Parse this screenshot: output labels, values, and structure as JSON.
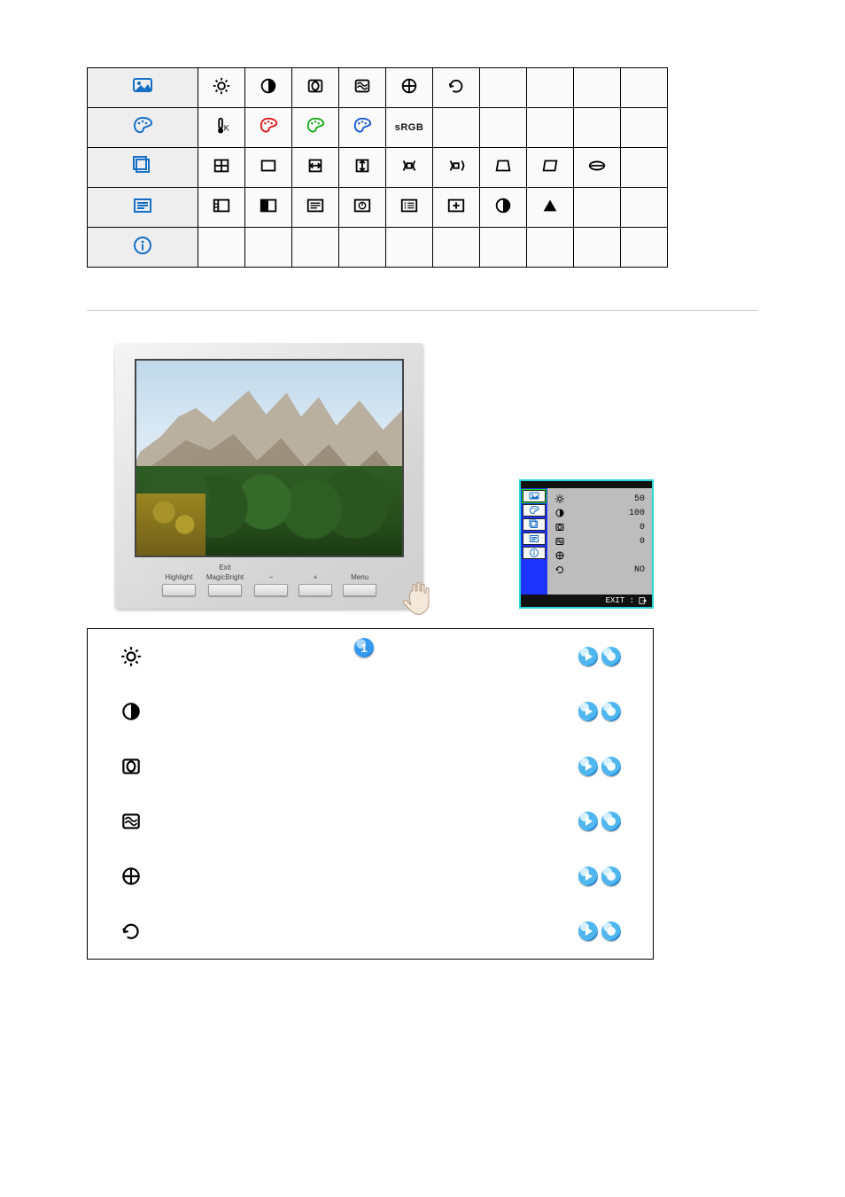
{
  "marker": "1",
  "icon_table": {
    "rows": [
      {
        "lead": "picture-main-icon",
        "cells": [
          "brightness-sun-icon",
          "contrast-halfmoon-icon",
          "degauss-icon",
          "moire-icon",
          "crosshair-icon",
          "recall-icon",
          "",
          "",
          "",
          ""
        ]
      },
      {
        "lead": "color-palette-icon",
        "cells": [
          "color-temp-icon",
          "palette-red-icon",
          "palette-green-icon",
          "palette-blue-icon",
          "srgb-label",
          "",
          "",
          "",
          "",
          ""
        ]
      },
      {
        "lead": "geometry-main-icon",
        "cells": [
          "h-position-icon",
          "h-size-icon",
          "h-center-icon",
          "v-position-icon",
          "pincushion-icon",
          "pinbalance-icon",
          "trapezoid-icon",
          "parallelogram-icon",
          "rotation-icon",
          ""
        ]
      },
      {
        "lead": "osd-main-icon",
        "cells": [
          "language-icon",
          "osd-halftone-icon",
          "osd-list-icon",
          "osd-timer-icon",
          "osd-menu-icon",
          "osd-position-icon",
          "contrast-halfmoon-icon",
          "triangle-icon",
          "",
          ""
        ]
      },
      {
        "lead": "info-icon",
        "cells": [
          "",
          "",
          "",
          "",
          "",
          "",
          "",
          "",
          "",
          ""
        ]
      }
    ],
    "srgb_label": "sRGB"
  },
  "monitor_buttons": [
    {
      "top": "",
      "bottom": "Highlight"
    },
    {
      "top": "Exit",
      "bottom": "MagicBright"
    },
    {
      "top": "",
      "bottom": "−"
    },
    {
      "top": "",
      "bottom": "+"
    },
    {
      "top": "",
      "bottom": "Menu"
    }
  ],
  "osd": {
    "tabs": [
      "picture-main-icon",
      "color-palette-icon",
      "geometry-main-icon",
      "osd-main-icon",
      "info-icon"
    ],
    "rows": [
      {
        "icon": "brightness-sun-icon",
        "value": "50"
      },
      {
        "icon": "contrast-halfmoon-icon",
        "value": "100"
      },
      {
        "icon": "degauss-icon",
        "value": "0"
      },
      {
        "icon": "moire-icon",
        "value": "0"
      },
      {
        "icon": "crosshair-icon",
        "value": ""
      },
      {
        "icon": "recall-icon",
        "value": "NO"
      }
    ],
    "exit_label": "EXIT :"
  },
  "item_list": [
    {
      "icon": "brightness-sun-icon"
    },
    {
      "icon": "contrast-halfmoon-icon"
    },
    {
      "icon": "degauss-icon"
    },
    {
      "icon": "moire-icon"
    },
    {
      "icon": "crosshair-icon"
    },
    {
      "icon": "recall-icon"
    }
  ]
}
